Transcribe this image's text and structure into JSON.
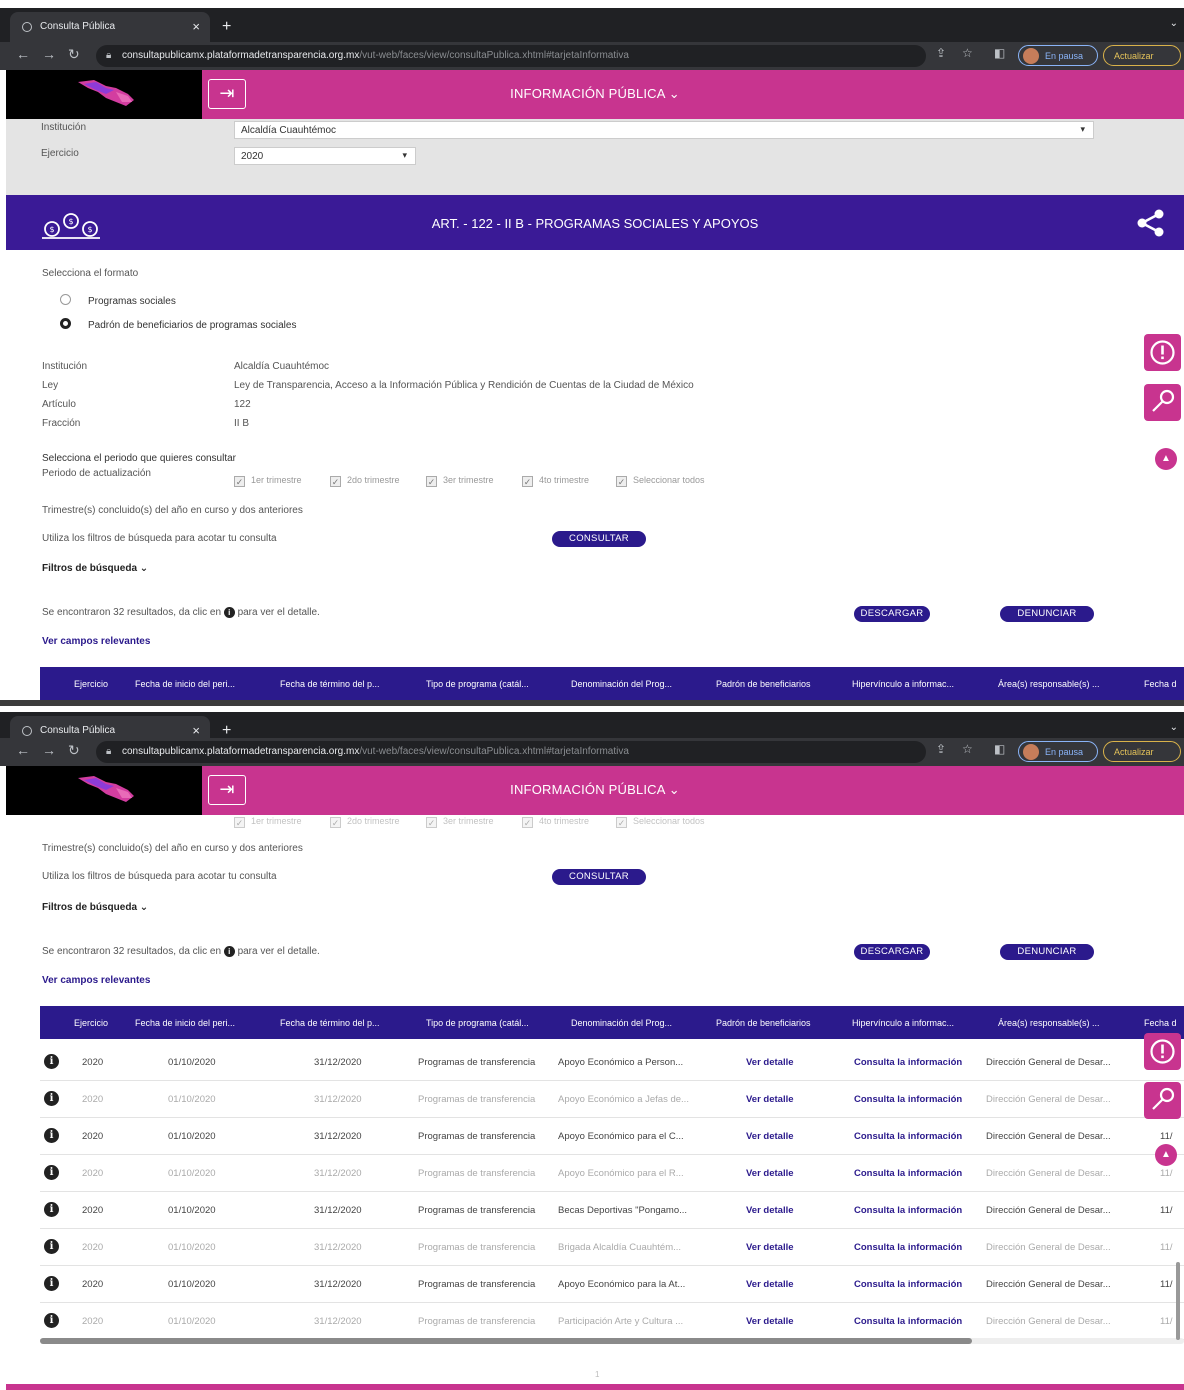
{
  "browser": {
    "tab_title": "Consulta Pública",
    "url_host": "consultapublicamx.plataformadetransparencia.org.mx",
    "url_path": "/vut-web/faces/view/consultaPublica.xhtml#tarjetaInformativa",
    "profile_label": "En pausa",
    "update_label": "Actualizar"
  },
  "header": {
    "menu_title": "INFORMACIÓN PÚBLICA"
  },
  "filters": {
    "institucion_label": "Institución",
    "institucion_value": "Alcaldía Cuauhtémoc",
    "ejercicio_label": "Ejercicio",
    "ejercicio_value": "2020"
  },
  "article": {
    "title": "ART. - 122 - II B - PROGRAMAS SOCIALES Y APOYOS"
  },
  "format": {
    "label": "Selecciona el formato",
    "options": [
      "Programas sociales",
      "Padrón de beneficiarios de programas sociales"
    ]
  },
  "info": [
    {
      "label": "Institución",
      "value": "Alcaldía Cuauhtémoc"
    },
    {
      "label": "Ley",
      "value": "Ley de Transparencia, Acceso a la Información Pública y Rendición de Cuentas de la Ciudad de México"
    },
    {
      "label": "Artículo",
      "value": "122"
    },
    {
      "label": "Fracción",
      "value": "II B"
    }
  ],
  "period": {
    "prompt": "Selecciona el periodo que quieres consultar",
    "label": "Periodo de actualización",
    "options": [
      "1er trimestre",
      "2do trimestre",
      "3er trimestre",
      "4to trimestre",
      "Seleccionar todos"
    ],
    "note": "Trimestre(s) concluido(s) del año en curso y dos anteriores",
    "filter_hint": "Utiliza los filtros de búsqueda para acotar tu consulta",
    "consult_label": "CONSULTAR",
    "filters_toggle": "Filtros de búsqueda"
  },
  "results": {
    "text_before": "Se encontraron 32 resultados, da clic en",
    "text_after": "para ver el detalle.",
    "download_label": "DESCARGAR",
    "report_label": "DENUNCIAR",
    "relevant_label": "Ver campos relevantes"
  },
  "table": {
    "headers": [
      "Ejercicio",
      "Fecha de inicio del peri...",
      "Fecha de término del p...",
      "Tipo de programa (catál...",
      "Denominación del Prog...",
      "Padrón de beneficiarios",
      "Hipervínculo a informac...",
      "Área(s) responsable(s) ...",
      "Fecha d"
    ],
    "rows": [
      {
        "ejercicio": "2020",
        "inicio": "01/10/2020",
        "termino": "31/12/2020",
        "tipo": "Programas de transferencia",
        "denominacion": "Apoyo Económico a Person...",
        "padron": "Ver detalle",
        "hiper": "Consulta la información",
        "area": "Dirección General de Desar...",
        "fecha": ""
      },
      {
        "ejercicio": "2020",
        "inicio": "01/10/2020",
        "termino": "31/12/2020",
        "tipo": "Programas de transferencia",
        "denominacion": "Apoyo Económico a Jefas de...",
        "padron": "Ver detalle",
        "hiper": "Consulta la información",
        "area": "Dirección General de Desar...",
        "fecha": ""
      },
      {
        "ejercicio": "2020",
        "inicio": "01/10/2020",
        "termino": "31/12/2020",
        "tipo": "Programas de transferencia",
        "denominacion": "Apoyo Económico para el C...",
        "padron": "Ver detalle",
        "hiper": "Consulta la información",
        "area": "Dirección General de Desar...",
        "fecha": "11/"
      },
      {
        "ejercicio": "2020",
        "inicio": "01/10/2020",
        "termino": "31/12/2020",
        "tipo": "Programas de transferencia",
        "denominacion": "Apoyo Económico para el R...",
        "padron": "Ver detalle",
        "hiper": "Consulta la información",
        "area": "Dirección General de Desar...",
        "fecha": "11/"
      },
      {
        "ejercicio": "2020",
        "inicio": "01/10/2020",
        "termino": "31/12/2020",
        "tipo": "Programas de transferencia",
        "denominacion": "Becas Deportivas \"Pongamo...",
        "padron": "Ver detalle",
        "hiper": "Consulta la información",
        "area": "Dirección General de Desar...",
        "fecha": "11/"
      },
      {
        "ejercicio": "2020",
        "inicio": "01/10/2020",
        "termino": "31/12/2020",
        "tipo": "Programas de transferencia",
        "denominacion": "Brigada Alcaldía Cuauhtém...",
        "padron": "Ver detalle",
        "hiper": "Consulta la información",
        "area": "Dirección General de Desar...",
        "fecha": "11/"
      },
      {
        "ejercicio": "2020",
        "inicio": "01/10/2020",
        "termino": "31/12/2020",
        "tipo": "Programas de transferencia",
        "denominacion": "Apoyo Económico para la At...",
        "padron": "Ver detalle",
        "hiper": "Consulta la información",
        "area": "Dirección General de Desar...",
        "fecha": "11/"
      },
      {
        "ejercicio": "2020",
        "inicio": "01/10/2020",
        "termino": "31/12/2020",
        "tipo": "Programas de transferencia",
        "denominacion": "Participación Arte y Cultura ...",
        "padron": "Ver detalle",
        "hiper": "Consulta la información",
        "area": "Dirección General de Desar...",
        "fecha": "11/"
      }
    ]
  },
  "pager": {
    "current": "1"
  },
  "colors": {
    "magenta": "#c8348f",
    "indigo": "#2b1a8c",
    "art_bar": "#3a1a96"
  }
}
